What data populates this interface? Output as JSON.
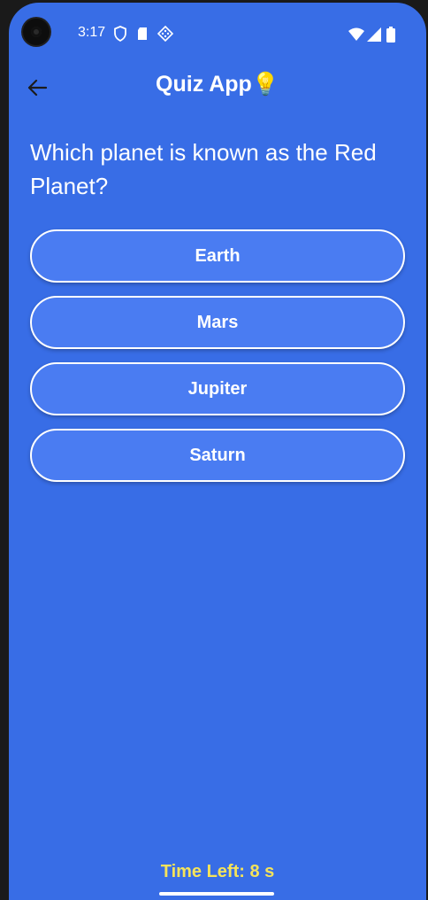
{
  "status_bar": {
    "time": "3:17"
  },
  "app_bar": {
    "title": "Quiz App💡"
  },
  "quiz": {
    "question": "Which planet is known as the Red Planet?",
    "options": [
      {
        "label": "Earth"
      },
      {
        "label": "Mars"
      },
      {
        "label": "Jupiter"
      },
      {
        "label": "Saturn"
      }
    ],
    "timer": "Time Left: 8 s"
  },
  "colors": {
    "background": "#386de6",
    "button_fill": "#4a7cf2",
    "timer_text": "#f5e35a"
  }
}
